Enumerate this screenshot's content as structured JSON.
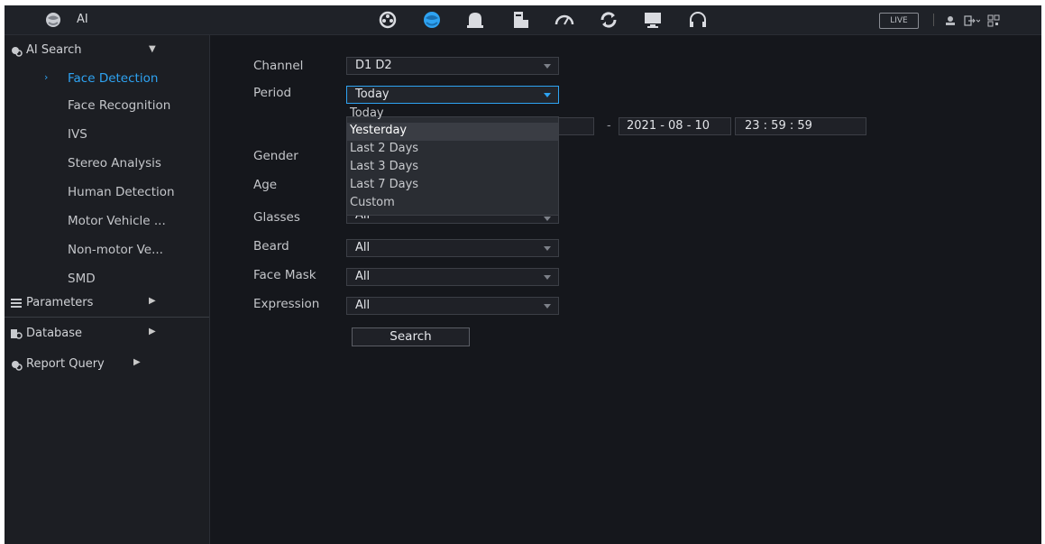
{
  "app": {
    "title": "AI",
    "logo_icon": "ai-globe-icon",
    "modules": [
      {
        "name": "camera-reel-icon"
      },
      {
        "name": "ai-globe-icon",
        "active": true
      },
      {
        "name": "alarm-bell-icon"
      },
      {
        "name": "storage-icon"
      },
      {
        "name": "network-gauge-icon"
      },
      {
        "name": "maintenance-refresh-icon"
      },
      {
        "name": "display-monitor-icon"
      },
      {
        "name": "audio-headset-icon"
      }
    ],
    "live_label": "LIVE",
    "accent_color": "#2ea3f2"
  },
  "sidebar": {
    "ai_search": {
      "label": "AI Search",
      "icon": "search-face-icon"
    },
    "items": [
      {
        "label": "Face Detection",
        "active": true
      },
      {
        "label": "Face Recognition"
      },
      {
        "label": "IVS"
      },
      {
        "label": "Stereo Analysis"
      },
      {
        "label": "Human Detection"
      },
      {
        "label": "Motor Vehicle ..."
      },
      {
        "label": "Non-motor Ve..."
      },
      {
        "label": "SMD"
      }
    ],
    "sections": [
      {
        "label": "Parameters",
        "icon": "list-icon"
      },
      {
        "label": "Database",
        "icon": "database-icon"
      },
      {
        "label": "Report Query",
        "icon": "report-search-icon"
      }
    ]
  },
  "form": {
    "channel": {
      "label": "Channel",
      "value": "D1 D2"
    },
    "period": {
      "label": "Period",
      "value": "Today",
      "options": [
        "Today",
        "Yesterday",
        "Last 2 Days",
        "Last 3 Days",
        "Last 7 Days",
        "Custom"
      ]
    },
    "end_date": "2021 - 08 - 10",
    "end_time": "23 : 59 : 59",
    "range_separator": "-",
    "gender": {
      "label": "Gender"
    },
    "age": {
      "label": "Age"
    },
    "glasses": {
      "label": "Glasses",
      "value": "All"
    },
    "beard": {
      "label": "Beard",
      "value": "All"
    },
    "face_mask": {
      "label": "Face Mask",
      "value": "All"
    },
    "expression": {
      "label": "Expression",
      "value": "All"
    },
    "search_label": "Search"
  }
}
